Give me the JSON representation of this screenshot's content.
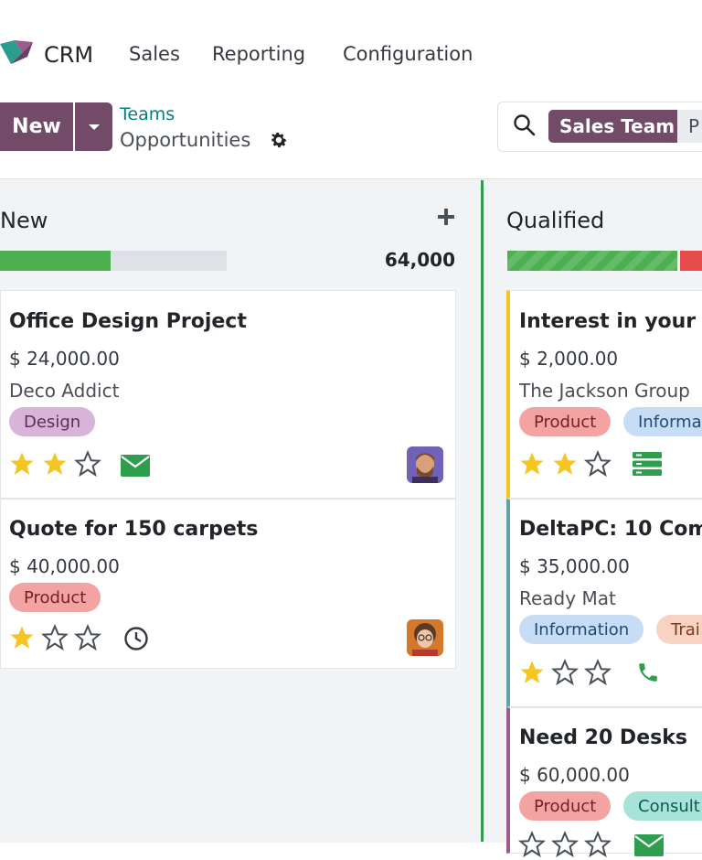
{
  "nav": {
    "app": "CRM",
    "menu": [
      "Sales",
      "Reporting",
      "Configuration"
    ]
  },
  "control": {
    "new_label": "New",
    "breadcrumb_parent": "Teams",
    "breadcrumb_current": "Opportunities",
    "search_facet": "Sales Team",
    "search_facet_next": "P"
  },
  "columns": [
    {
      "title": "New",
      "total": "64,000",
      "progress": {
        "green": 0.49
      },
      "cards": [
        {
          "title": "Office Design Project",
          "amount": "$ 24,000.00",
          "company": "Deco Addict",
          "tags": [
            "Design"
          ],
          "stars": 2,
          "activity": "email-icon",
          "avatar": "man"
        },
        {
          "title": "Quote for 150 carpets",
          "amount": "$ 40,000.00",
          "company": "",
          "tags": [
            "Product"
          ],
          "stars": 1,
          "activity": "clock-icon",
          "avatar": "woman"
        }
      ]
    },
    {
      "title": "Qualified",
      "total": "",
      "cards": [
        {
          "title": "Interest in your p",
          "amount": "$ 2,000.00",
          "company": "The Jackson Group",
          "tags": [
            "Product",
            "Informa"
          ],
          "stars": 2,
          "activity": "tasks-icon"
        },
        {
          "title": "DeltaPC: 10 Com",
          "amount": "$ 35,000.00",
          "company": "Ready Mat",
          "tags": [
            "Information",
            "Trai"
          ],
          "stars": 1,
          "activity": "phone-icon"
        },
        {
          "title": "Need 20 Desks",
          "amount": "$ 60,000.00",
          "company": "",
          "tags": [
            "Product",
            "Consult"
          ],
          "stars": 0,
          "activity": "email-icon"
        }
      ]
    }
  ],
  "colors": {
    "brand": "#714b67",
    "link": "#017e84",
    "star": "#f3c623",
    "green": "#2e9e4e"
  }
}
